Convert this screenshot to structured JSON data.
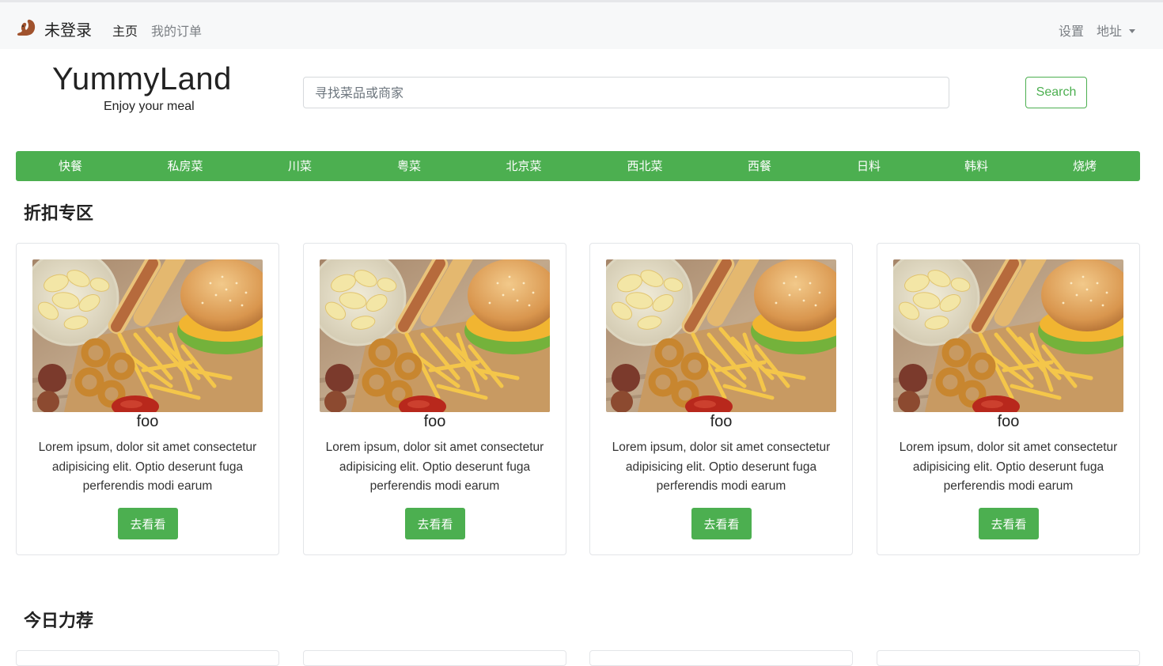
{
  "topbar": {
    "brand_icon": "squirrel-icon",
    "brand_label": "未登录",
    "nav_home": "主页",
    "nav_orders": "我的订单",
    "settings": "设置",
    "address": "地址"
  },
  "header": {
    "logo_title": "YummyLand",
    "logo_subtitle": "Enjoy your meal",
    "search_placeholder": "寻找菜品或商家",
    "search_value": "",
    "search_button": "Search"
  },
  "categories": [
    "快餐",
    "私房菜",
    "川菜",
    "粤菜",
    "北京菜",
    "西北菜",
    "西餐",
    "日料",
    "韩料",
    "烧烤"
  ],
  "discount_section": {
    "title": "折扣专区",
    "cards": [
      {
        "title": "foo",
        "text": "Lorem ipsum, dolor sit amet consectetur adipisicing elit. Optio deserunt fuga perferendis modi earum",
        "button": "去看看",
        "image": "fast-food-photo"
      },
      {
        "title": "foo",
        "text": "Lorem ipsum, dolor sit amet consectetur adipisicing elit. Optio deserunt fuga perferendis modi earum",
        "button": "去看看",
        "image": "fast-food-photo"
      },
      {
        "title": "foo",
        "text": "Lorem ipsum, dolor sit amet consectetur adipisicing elit. Optio deserunt fuga perferendis modi earum",
        "button": "去看看",
        "image": "fast-food-photo"
      },
      {
        "title": "foo",
        "text": "Lorem ipsum, dolor sit amet consectetur adipisicing elit. Optio deserunt fuga perferendis modi earum",
        "button": "去看看",
        "image": "fast-food-photo"
      }
    ]
  },
  "recommend_section": {
    "title": "今日力荐"
  },
  "colors": {
    "accent": "#4caf50",
    "topbar_bg": "#f7f8f9",
    "muted_text": "#7b7f84"
  }
}
